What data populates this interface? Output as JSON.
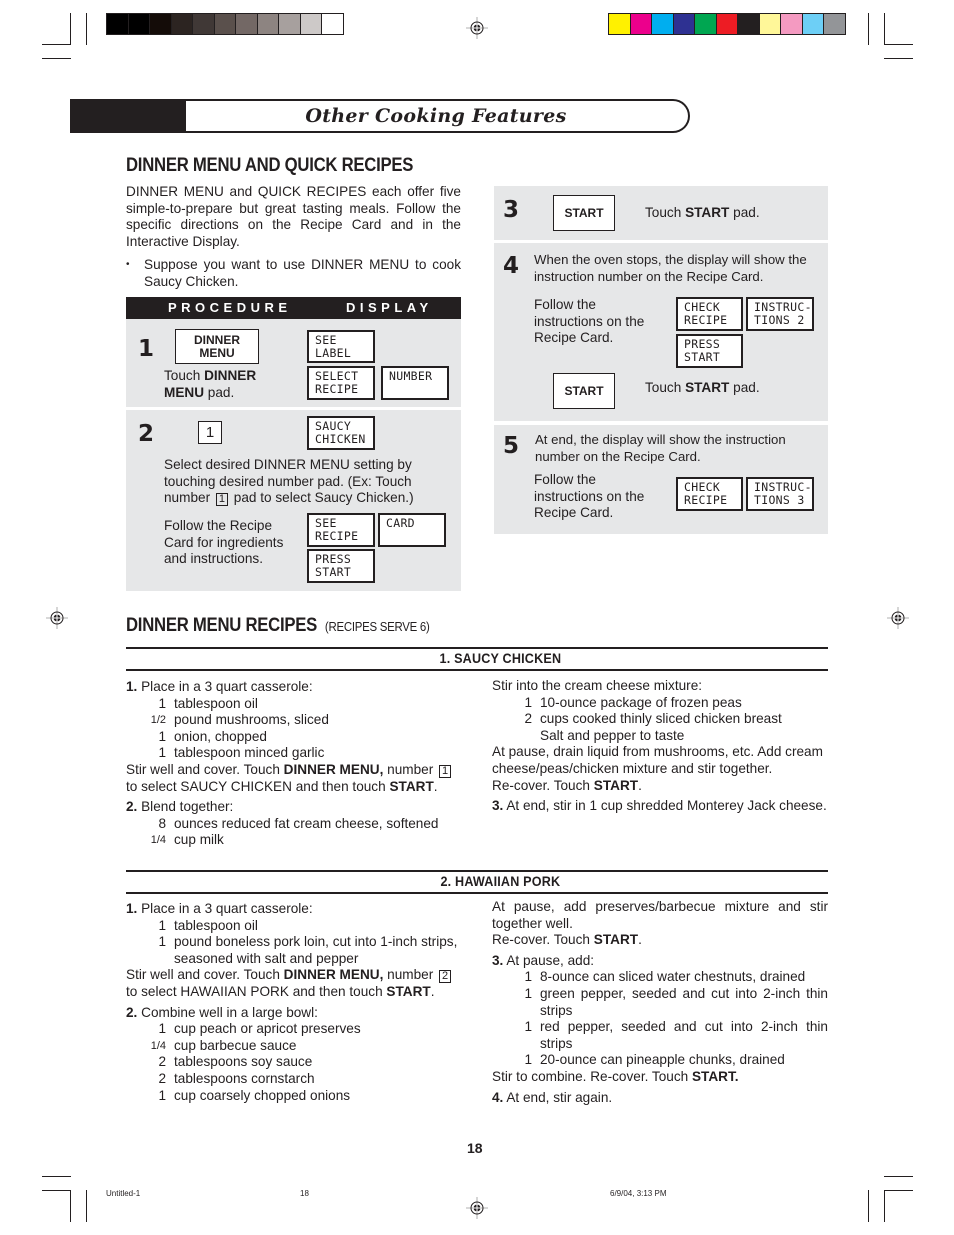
{
  "print_marks": {
    "grayscale_swatches": [
      "#000000",
      "#000000",
      "#140c08",
      "#2c2421",
      "#403836",
      "#5a504c",
      "#736865",
      "#8d8481",
      "#a7a09e",
      "#cdc9c8",
      "#ffffff"
    ],
    "color_swatches": [
      "#fff100",
      "#ec008c",
      "#00aeef",
      "#2e3192",
      "#00a651",
      "#ed1c24",
      "#231f20",
      "#fff799",
      "#f49ac1",
      "#6dcff6",
      "#939598"
    ]
  },
  "header": {
    "title": "Other Cooking Features"
  },
  "intro": {
    "heading": "DINNER MENU AND QUICK RECIPES",
    "paragraph": "DINNER MENU and QUICK RECIPES each offer five simple-to-prepare but great tasting meals. Follow the specific directions on the Recipe Card and in the Interactive Display.",
    "bullet": "Suppose you want to use DINNER MENU to cook Saucy Chicken."
  },
  "procedure": {
    "col_procedure": "PROCEDURE",
    "col_display": "DISPLAY",
    "step1": {
      "num": "1",
      "pad": "DINNER MENU",
      "text_pre": "Touch ",
      "text_bold": "DINNER MENU",
      "text_post": " pad.",
      "lcd": [
        "SEE\nLABEL",
        "SELECT\nRECIPE",
        "NUMBER"
      ]
    },
    "step2": {
      "num": "2",
      "pad": "1",
      "text_a": "Select desired DINNER MENU setting by touching desired number pad. (Ex: Touch number ",
      "key": "1",
      "text_b": " pad to select Saucy Chicken.)",
      "follow": "Follow the Recipe Card for ingredients and instructions.",
      "lcd": [
        "SAUCY\nCHICKEN",
        "SEE\nRECIPE",
        "CARD",
        "PRESS\nSTART"
      ]
    },
    "step3": {
      "num": "3",
      "pad": "START",
      "text_pre": "Touch ",
      "text_bold": "START",
      "text_post": " pad."
    },
    "step4": {
      "num": "4",
      "text": "When the oven stops, the display will show the instruction number on the Recipe Card.",
      "follow": "Follow the instructions on the Recipe Card.",
      "lcd": [
        "CHECK\nRECIPE",
        "INSTRUC-\nTIONS 2",
        "PRESS\nSTART"
      ],
      "pad": "START",
      "text_pre": "Touch ",
      "text_bold": "START",
      "text_post": " pad."
    },
    "step5": {
      "num": "5",
      "text": "At end, the display will show the instruction number on the Recipe Card.",
      "follow": "Follow the instructions on the Recipe Card.",
      "lcd": [
        "CHECK\nRECIPE",
        "INSTRUC-\nTIONS 3"
      ]
    }
  },
  "recipes": {
    "heading": "DINNER MENU RECIPES",
    "subheading": "(RECIPES SERVE 6)",
    "saucy": {
      "title": "1. SAUCY CHICKEN",
      "s1_label": "1.",
      "s1_text": " Place in a 3 quart casserole:",
      "s1_ing": [
        {
          "q": "1",
          "t": "tablespoon oil"
        },
        {
          "q": "1/2",
          "t": "pound mushrooms, sliced"
        },
        {
          "q": "1",
          "t": "onion, chopped"
        },
        {
          "q": "1",
          "t": "tablespoon minced garlic"
        }
      ],
      "s1_after_a": "Stir well and cover. Touch ",
      "s1_after_bold": "DINNER MENU,",
      "s1_after_b": " number ",
      "s1_key": "1",
      "s1_after_c": "to select SAUCY CHICKEN and then touch ",
      "s1_after_bold2": "START",
      "s1_after_d": ".",
      "s2_label": "2.",
      "s2_text": " Blend together:",
      "s2_ing": [
        {
          "q": "8",
          "t": "ounces reduced fat cream cheese, softened"
        },
        {
          "q": "1/4",
          "t": "cup milk"
        }
      ],
      "r_intro": "Stir into the cream cheese mixture:",
      "r_ing": [
        {
          "q": "1",
          "t": "10-ounce package of frozen peas"
        },
        {
          "q": "2",
          "t": "cups cooked thinly sliced chicken breast"
        },
        {
          "q": "",
          "t": "Salt and pepper to taste"
        }
      ],
      "r_pause": "At pause, drain liquid from mushrooms, etc. Add cream cheese/peas/chicken mixture and stir together.",
      "r_recover": "Re-cover. Touch ",
      "r_recover_bold": "START",
      "s3_label": "3.",
      "s3_text": " At end, stir in 1 cup shredded Monterey Jack cheese."
    },
    "hawaiian": {
      "title": "2. HAWAIIAN PORK",
      "s1_label": "1.",
      "s1_text": " Place in a 3 quart casserole:",
      "s1_ing": [
        {
          "q": "1",
          "t": "tablespoon oil"
        },
        {
          "q": "1",
          "t": "pound boneless pork loin, cut into 1-inch strips, seasoned with salt and pepper"
        }
      ],
      "s1_after_a": "Stir well and cover. Touch ",
      "s1_after_bold": "DINNER MENU,",
      "s1_after_b": " number ",
      "s1_key": "2",
      "s1_after_c": "to select HAWAIIAN PORK and then touch ",
      "s1_after_bold2": "START",
      "s1_after_d": ".",
      "s2_label": "2.",
      "s2_text": " Combine well in a large bowl:",
      "s2_ing": [
        {
          "q": "1",
          "t": "cup peach or apricot preserves"
        },
        {
          "q": "1/4",
          "t": "cup barbecue sauce"
        },
        {
          "q": "2",
          "t": "tablespoons soy sauce"
        },
        {
          "q": "2",
          "t": "tablespoons cornstarch"
        },
        {
          "q": "1",
          "t": "cup coarsely chopped onions"
        }
      ],
      "r_pause": "At pause, add preserves/barbecue mixture and stir together well.",
      "r_recover": "Re-cover. Touch ",
      "r_recover_bold": "START",
      "s3_label": "3.",
      "s3_text": " At pause, add:",
      "s3_ing": [
        {
          "q": "1",
          "t": "8-ounce can sliced water chestnuts, drained"
        },
        {
          "q": "1",
          "t": "green pepper, seeded and cut into 2-inch thin strips"
        },
        {
          "q": "1",
          "t": "red pepper, seeded and cut into 2-inch thin strips"
        },
        {
          "q": "1",
          "t": "20-ounce can pineapple chunks, drained"
        }
      ],
      "s3_after": "Stir to combine. Re-cover. Touch ",
      "s3_after_bold": "START.",
      "s4_label": "4.",
      "s4_text": " At end, stir again."
    }
  },
  "page_number": "18",
  "slug": {
    "file": "Untitled-1",
    "page": "18",
    "timestamp": "6/9/04, 3:13 PM"
  }
}
